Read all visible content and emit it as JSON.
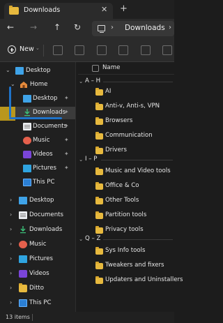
{
  "window": {
    "tab_title": "Downloads",
    "close_glyph": "✕",
    "new_tab_glyph": "+"
  },
  "nav": {
    "back_glyph": "←",
    "forward_glyph": "→",
    "up_glyph": "↑",
    "refresh_glyph": "↻",
    "address_chevron": "›",
    "address_text": "Downloads",
    "address_chevron2": "›"
  },
  "command_bar": {
    "new_label": "New",
    "new_caret": "⌄"
  },
  "sidebar": {
    "desktop": "Desktop",
    "home": "Home",
    "quick": [
      {
        "label": "Desktop"
      },
      {
        "label": "Downloads"
      },
      {
        "label": "Documents"
      },
      {
        "label": "Music"
      },
      {
        "label": "Videos"
      },
      {
        "label": "Pictures"
      },
      {
        "label": "This PC"
      }
    ],
    "tree": [
      {
        "label": "Desktop"
      },
      {
        "label": "Documents"
      },
      {
        "label": "Downloads"
      },
      {
        "label": "Music"
      },
      {
        "label": "Pictures"
      },
      {
        "label": "Videos"
      },
      {
        "label": "Ditto"
      },
      {
        "label": "This PC"
      }
    ]
  },
  "content": {
    "column_name": "Name",
    "groups": [
      {
        "title": "A – H",
        "items": [
          "AI",
          "Anti-v, Anti-s, VPN",
          "Browsers",
          "Communication",
          "Drivers"
        ]
      },
      {
        "title": "I – P",
        "items": [
          "Music and Video tools",
          "Office & Co",
          "Other Tools",
          "Partition tools",
          "Privacy tools"
        ]
      },
      {
        "title": "Q – Z",
        "items": [
          "Sys Info tools",
          "Tweakers and fixers",
          "Updaters and Uninstallers"
        ]
      }
    ]
  },
  "status": {
    "items_count": "13 items"
  },
  "colors": {
    "folder": "#e7b93e",
    "accent": "#1f73c9",
    "mark": "#c8a21b",
    "background": "#1c1c1c"
  }
}
